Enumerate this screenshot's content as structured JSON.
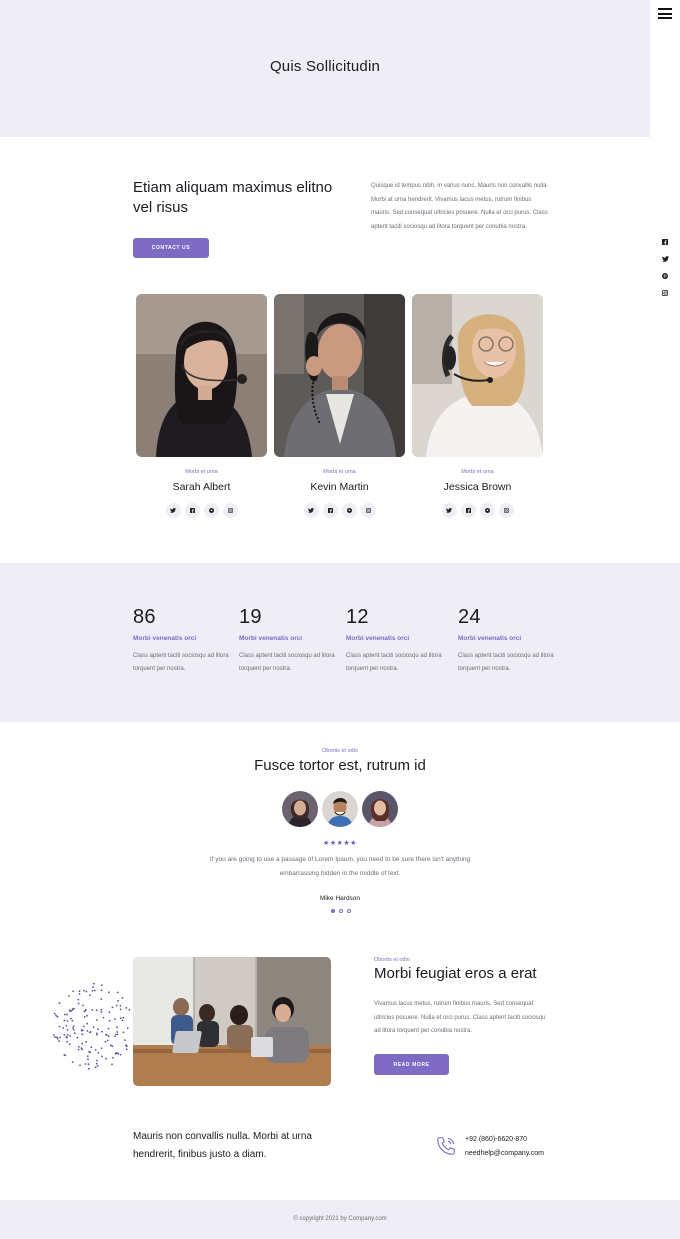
{
  "hero": {
    "title": "Quis Sollicitudin"
  },
  "menu": {
    "icon": "hamburger-menu-icon"
  },
  "side_social": [
    "facebook-icon",
    "twitter-icon",
    "pinterest-icon",
    "instagram-icon"
  ],
  "intro": {
    "heading": "Etiam aliquam maximus elitno vel risus",
    "button": "CONTACT US",
    "paragraph": "Quisque id tempus nibh, in varius nunc. Mauris non convallis nulla. Morbi at urna hendrerit. Vivamus lacus metus, rutrum finibus mauris. Sed consequat ultricies posuere. Nulla et orci purus. Class aptent taciti sociosqu ad litora torquent per conubia nostra."
  },
  "team": [
    {
      "role": "Morbi et urna",
      "name": "Sarah Albert"
    },
    {
      "role": "Morbi et urna",
      "name": "Kevin Martin"
    },
    {
      "role": "Morbi et urna",
      "name": "Jessica Brown"
    }
  ],
  "stats": [
    {
      "value": "86",
      "label": "Morbi venenatis orci",
      "text": "Class aptent taciti sociosqu ad litora torquent per nostra."
    },
    {
      "value": "19",
      "label": "Morbi venenatis orci",
      "text": "Class aptent taciti sociosqu ad litora torquent per nostra."
    },
    {
      "value": "12",
      "label": "Morbi venenatis orci",
      "text": "Class aptent taciti sociosqu ad litora torquent per nostra."
    },
    {
      "value": "24",
      "label": "Morbi venenatis orci",
      "text": "Class aptent taciti sociosqu ad litora torquent per nostra."
    }
  ],
  "testimonial": {
    "eyebrow": "Obortis et odio",
    "title": "Fusce tortor est, rutrum id",
    "stars": "★★★★★",
    "rating": 5,
    "text": "If you are going to use a passage of Lorem Ipsum, you need to be sure there isn't anything embarrassing hidden in the middle of text.",
    "author": "Mike Hardson",
    "slides": 3,
    "active_slide": 1
  },
  "feature": {
    "eyebrow": "Obortis et odio",
    "title": "Morbi feugiat eros a erat",
    "paragraph": "Vivamus lacus metus, rutrum finibus mauris. Sed consequat ultricies posuere. Nulla et orci purus. Class aptent taciti sociosqu ad litora torquent per conubia nostra.",
    "button": "READ MORE"
  },
  "cta": {
    "text": "Mauris non convallis nulla. Morbi at urna hendrerit, finibus justo a diam.",
    "phone": "+92 (860)-6620-870",
    "email": "needhelp@company.com"
  },
  "footer": {
    "copyright": "© copyright 2021 by Company.com"
  },
  "colors": {
    "accent": "#7f6bc4",
    "panel": "#efeef6",
    "text": "#1b1b22",
    "muted": "#6d6b78"
  }
}
